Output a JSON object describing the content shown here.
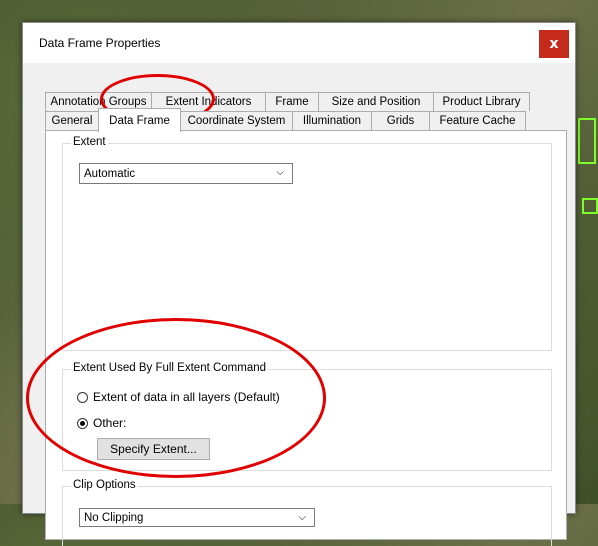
{
  "window": {
    "title": "Data Frame Properties",
    "close_label": "x"
  },
  "tabs_row1": [
    "Annotation Groups",
    "Extent Indicators",
    "Frame",
    "Size and Position",
    "Product Library"
  ],
  "tabs_row2": [
    "General",
    "Data Frame",
    "Coordinate System",
    "Illumination",
    "Grids",
    "Feature Cache"
  ],
  "active_tab": "Data Frame",
  "extent": {
    "label": "Extent",
    "value": "Automatic"
  },
  "full_extent": {
    "label": "Extent Used By Full Extent Command",
    "option_default": "Extent of data in all layers (Default)",
    "option_other": "Other:",
    "selected": "Other:",
    "specify_button": "Specify Extent..."
  },
  "clip": {
    "label": "Clip Options",
    "value": "No Clipping"
  },
  "colors": {
    "annotation": "#e00000",
    "map_feature": "#7cff2a",
    "close": "#c42b1c"
  }
}
